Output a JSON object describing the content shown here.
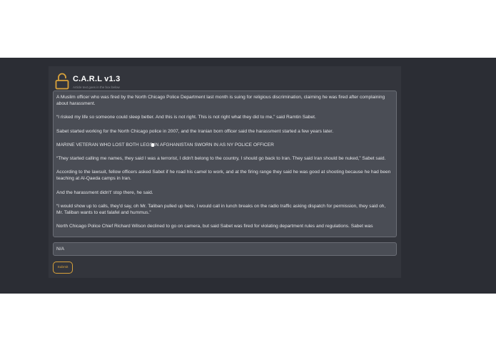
{
  "app": {
    "title": "C.A.R.L v1.3",
    "subtitle": "Article text goes in the box below",
    "accent_color": "#d9a23b",
    "icon": "lock-open-icon"
  },
  "article": {
    "paragraphs": [
      "A Muslim officer who was fired by the North Chicago Police Department last month is suing for religious discrimination, claiming he was fired after complaining about harassment.",
      "“I risked my life so someone could sleep better. And this is not right. This is not right what they did to me,” said Ramtin Sabet.",
      "Sabet started working for the North Chicago police in 2007, and the Iranian born officer said the harassment started a few years later.",
      "MARINE VETERAN WHO LOST BOTH LEGS IN AFGHANISTAN SWORN IN AS NY POLICE OFFICER",
      "“They started calling me names, they said I was a terrorist, I didn't belong to the country, I should go back to Iran. They said Iran should be nuked,” Sabet said.",
      "According to the lawsuit, fellow officers asked Sabet if he road his camel to work, and at the firing range they said he was good at shooting because he had been teaching at Al-Qaeda camps in Iran.",
      "And the harassment didn't' stop there, he said.",
      "“I would show up to calls, they'd say, oh Mr. Taliban pulled up here, I would call in lunch breaks on the radio traffic asking dispatch for permission, they said oh, Mr. Taliban wants to eat falafel and hummus.”",
      "North Chicago Police Chief Richard Wilson declined to go on camera, but said Sabet was fired for violating department rules and regulations. Sabet was"
    ]
  },
  "answer": {
    "value": "N/A"
  },
  "submit": {
    "label": "Submit"
  }
}
